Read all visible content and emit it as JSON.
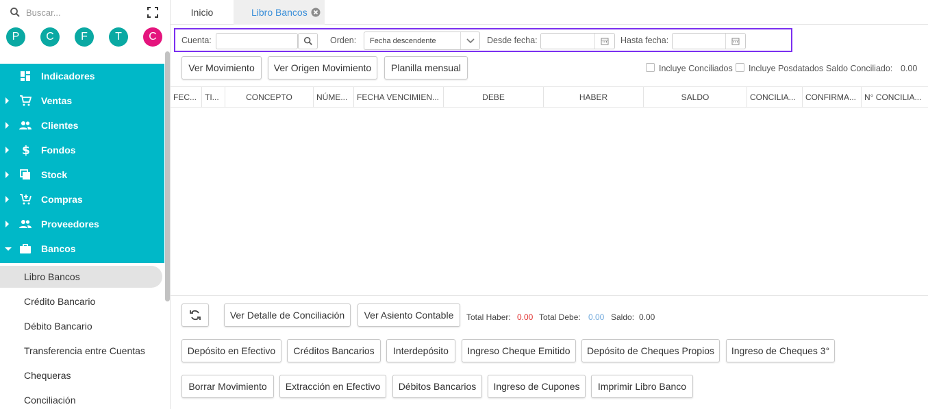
{
  "sidebar": {
    "search_placeholder": "Buscar...",
    "avatars": [
      {
        "letter": "P",
        "color": "#0aa9a3"
      },
      {
        "letter": "C",
        "color": "#0aa9a3"
      },
      {
        "letter": "F",
        "color": "#0aa9a3"
      },
      {
        "letter": "T",
        "color": "#0aa9a3"
      },
      {
        "letter": "C",
        "color": "#e4147d"
      }
    ],
    "menu": [
      {
        "label": "Indicadores",
        "icon": "dashboard-icon"
      },
      {
        "label": "Ventas",
        "icon": "cart-icon"
      },
      {
        "label": "Clientes",
        "icon": "people-icon"
      },
      {
        "label": "Fondos",
        "icon": "dollar-icon"
      },
      {
        "label": "Stock",
        "icon": "stack-icon"
      },
      {
        "label": "Compras",
        "icon": "cart-plus-icon"
      },
      {
        "label": "Proveedores",
        "icon": "people-icon"
      },
      {
        "label": "Bancos",
        "icon": "briefcase-icon"
      }
    ],
    "submenu": [
      "Libro Bancos",
      "Crédito Bancario",
      "Débito Bancario",
      "Transferencia entre Cuentas",
      "Chequeras",
      "Conciliación"
    ]
  },
  "tabs": [
    "Inicio",
    "Libro Bancos"
  ],
  "filters": {
    "cuenta_label": "Cuenta:",
    "orden_label": "Orden:",
    "orden_value": "Fecha descendente",
    "desde_label": "Desde fecha:",
    "hasta_label": "Hasta fecha:"
  },
  "actions_top": [
    "Ver Movimiento",
    "Ver Origen Movimiento",
    "Planilla mensual"
  ],
  "options": {
    "incluye_conciliados": "Incluye Conciliados",
    "incluye_posdatados": "Incluye Posdatados",
    "saldo_conciliado_label": "Saldo Conciliado:",
    "saldo_conciliado_value": "0.00"
  },
  "columns": [
    "FEC...",
    "TI...",
    "CONCEPTO",
    "NÚME...",
    "FECHA VENCIMIEN...",
    "DEBE",
    "HABER",
    "SALDO",
    "CONCILIA...",
    "CONFIRMA...",
    "N° CONCILIA..."
  ],
  "bottom": {
    "ver_detalle": "Ver Detalle de Conciliación",
    "ver_asiento": "Ver Asiento Contable",
    "total_haber_label": "Total Haber:",
    "total_haber_value": "0.00",
    "total_debe_label": "Total Debe:",
    "total_debe_value": "0.00",
    "saldo_label": "Saldo:",
    "saldo_value": "0.00",
    "colors": {
      "haber": "#e0302e",
      "debe": "#6fa8dc"
    }
  },
  "actions_row1": [
    "Depósito en Efectivo",
    "Créditos Bancarios",
    "Interdepósito",
    "Ingreso Cheque Emitido",
    "Depósito de Cheques Propios",
    "Ingreso de Cheques 3°"
  ],
  "actions_row2": [
    "Borrar Movimiento",
    "Extracción en Efectivo",
    "Débitos Bancarios",
    "Ingreso de Cupones",
    "Imprimir Libro Banco"
  ],
  "accent": "#00b8c8",
  "highlight": "#7b2ff0"
}
